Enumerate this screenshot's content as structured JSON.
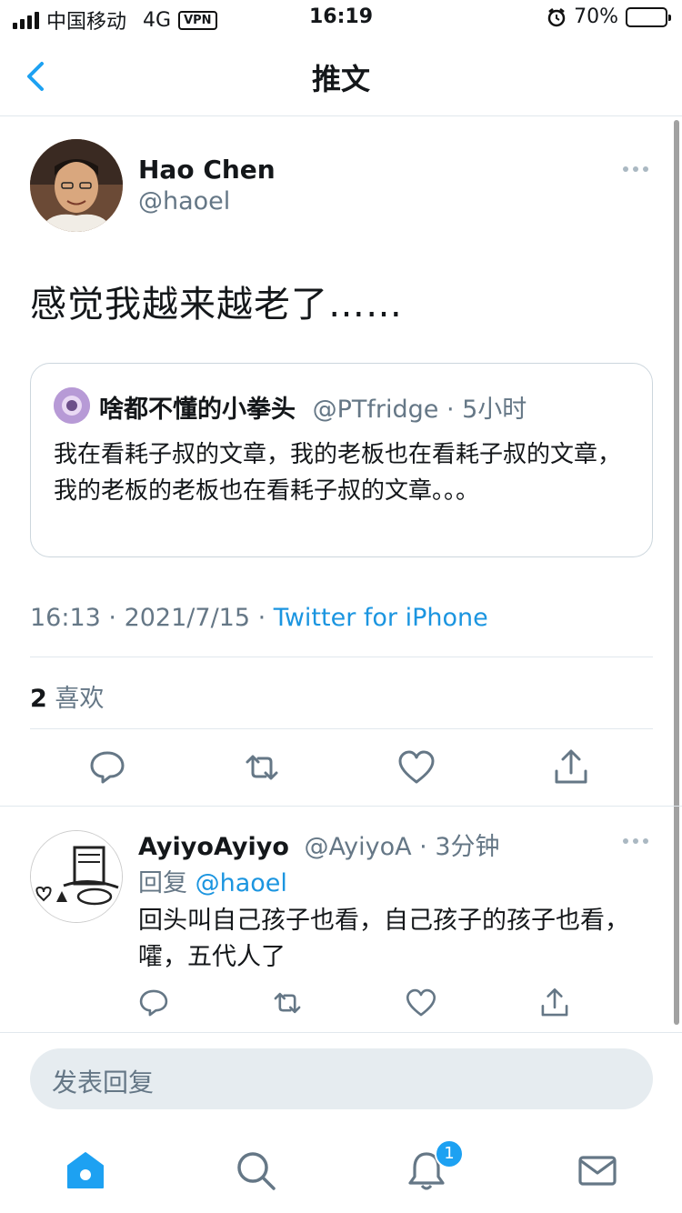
{
  "status_bar": {
    "carrier": "中国移动",
    "network": "4G",
    "vpn": "VPN",
    "time": "16:19",
    "battery": "70%",
    "battery_level": 0.7
  },
  "nav": {
    "title": "推文"
  },
  "tweet": {
    "author_name": "Hao Chen",
    "author_handle": "@haoel",
    "text": "感觉我越来越老了……",
    "quote": {
      "name": "啥都不懂的小拳头",
      "meta": "@PTfridge · 5小时",
      "text": "我在看耗子叔的文章，我的老板也在看耗子叔的文章，我的老板的老板也在看耗子叔的文章。。。"
    },
    "time": "16:13",
    "date": "2021/7/15",
    "source": "Twitter for iPhone",
    "likes_count": "2",
    "likes_label": "喜欢"
  },
  "reply": {
    "name": "AyiyoAyiyo",
    "meta": "@AyiyoA · 3分钟",
    "reply_prefix": "回复",
    "reply_to": "@haoel",
    "text": "回头叫自己孩子也看，自己孩子的孩子也看，嚯，五代人了"
  },
  "compose": {
    "placeholder": "发表回复"
  },
  "tabbar": {
    "notifications_badge": "1"
  },
  "colors": {
    "accent": "#1da1f2",
    "link": "#1b95e0",
    "secondary_text": "#657786"
  }
}
